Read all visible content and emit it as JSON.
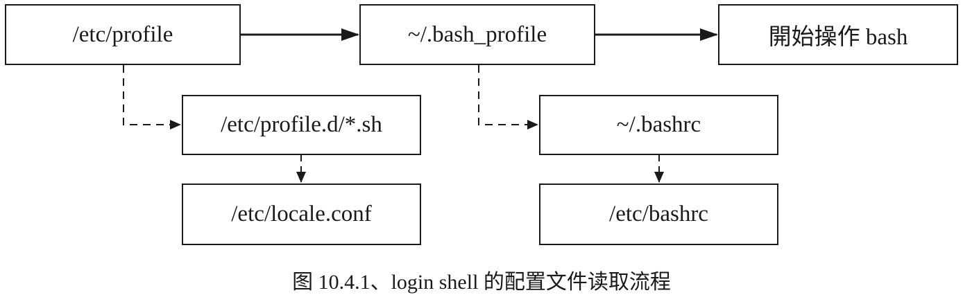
{
  "diagram": {
    "nodes": {
      "etc_profile": "/etc/profile",
      "bash_profile": "~/.bash_profile",
      "start_bash": "開始操作 bash",
      "profile_d": "/etc/profile.d/*.sh",
      "bashrc_user": "~/.bashrc",
      "locale_conf": "/etc/locale.conf",
      "etc_bashrc": "/etc/bashrc"
    },
    "edges": [
      {
        "from": "etc_profile",
        "to": "bash_profile",
        "style": "solid"
      },
      {
        "from": "bash_profile",
        "to": "start_bash",
        "style": "solid"
      },
      {
        "from": "etc_profile",
        "to": "profile_d",
        "style": "dashed"
      },
      {
        "from": "bash_profile",
        "to": "bashrc_user",
        "style": "dashed"
      },
      {
        "from": "profile_d",
        "to": "locale_conf",
        "style": "dashed"
      },
      {
        "from": "bashrc_user",
        "to": "etc_bashrc",
        "style": "dashed"
      }
    ]
  },
  "caption": "图 10.4.1、login shell  的配置文件读取流程",
  "colors": {
    "line": "#1a1a1a",
    "background": "#ffffff"
  }
}
